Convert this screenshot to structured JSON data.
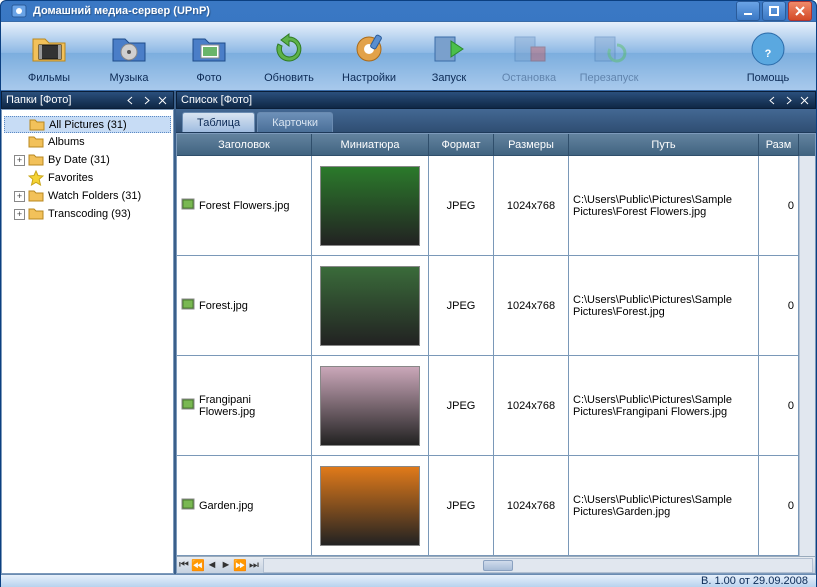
{
  "window": {
    "title": "Домашний медиа-сервер (UPnP)"
  },
  "toolbar": {
    "films": "Фильмы",
    "music": "Музыка",
    "photo": "Фото",
    "refresh": "Обновить",
    "settings": "Настройки",
    "start": "Запуск",
    "stop": "Остановка",
    "restart": "Перезапуск",
    "help": "Помощь"
  },
  "leftPanel": {
    "caption": "Папки [Фото]"
  },
  "tree": [
    {
      "label": "All Pictures (31)",
      "icon": "folder",
      "exp": "",
      "indent": 1,
      "selected": true
    },
    {
      "label": "Albums",
      "icon": "folder",
      "exp": "",
      "indent": 1
    },
    {
      "label": "By Date (31)",
      "icon": "folder",
      "exp": "+",
      "indent": 1
    },
    {
      "label": "Favorites",
      "icon": "star",
      "exp": "",
      "indent": 1
    },
    {
      "label": "Watch Folders (31)",
      "icon": "folder",
      "exp": "+",
      "indent": 1
    },
    {
      "label": "Transcoding (93)",
      "icon": "folder",
      "exp": "+",
      "indent": 1
    }
  ],
  "rightPanel": {
    "caption": "Список [Фото]"
  },
  "tabs": {
    "table": "Таблица",
    "cards": "Карточки"
  },
  "columns": {
    "title": "Заголовок",
    "thumb": "Миниатюра",
    "format": "Формат",
    "dims": "Размеры",
    "path": "Путь",
    "size": "Разм"
  },
  "rows": [
    {
      "title": "Forest Flowers.jpg",
      "format": "JPEG",
      "dims": "1024x768",
      "path": "C:\\Users\\Public\\Pictures\\Sample Pictures\\Forest Flowers.jpg",
      "size": "0",
      "thumb": "#2b7a2b"
    },
    {
      "title": "Forest.jpg",
      "format": "JPEG",
      "dims": "1024x768",
      "path": "C:\\Users\\Public\\Pictures\\Sample Pictures\\Forest.jpg",
      "size": "0",
      "thumb": "#3a6b3a"
    },
    {
      "title": "Frangipani Flowers.jpg",
      "format": "JPEG",
      "dims": "1024x768",
      "path": "C:\\Users\\Public\\Pictures\\Sample Pictures\\Frangipani Flowers.jpg",
      "size": "0",
      "thumb": "#caa7b9"
    },
    {
      "title": "Garden.jpg",
      "format": "JPEG",
      "dims": "1024x768",
      "path": "C:\\Users\\Public\\Pictures\\Sample Pictures\\Garden.jpg",
      "size": "0",
      "thumb": "#e07a1a"
    }
  ],
  "status": {
    "version": "В. 1.00 от 29.09.2008"
  }
}
